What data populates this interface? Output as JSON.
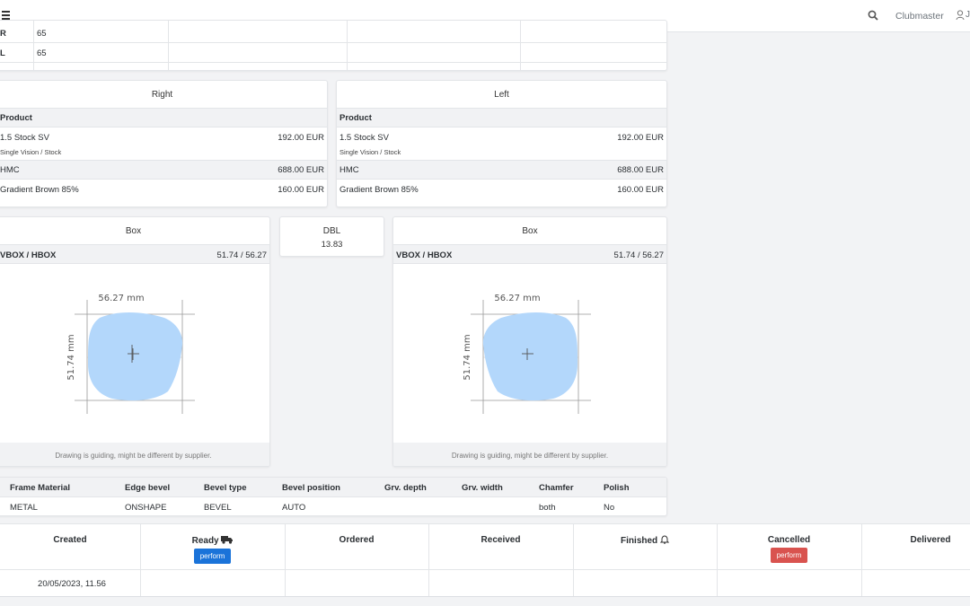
{
  "topbar": {
    "brand": "Clubmaster",
    "user_initial": "J"
  },
  "pd_table": {
    "rows": [
      {
        "side": "R",
        "value": "65"
      },
      {
        "side": "L",
        "value": "65"
      }
    ]
  },
  "lens_right": {
    "title": "Right",
    "product_label": "Product",
    "items": [
      {
        "name": "1.5 Stock SV",
        "sub": "Single Vision / Stock",
        "price": "192.00 EUR"
      },
      {
        "name": "HMC",
        "price": "688.00 EUR"
      },
      {
        "name": "Gradient Brown 85%",
        "price": "160.00 EUR"
      }
    ]
  },
  "lens_left": {
    "title": "Left",
    "product_label": "Product",
    "items": [
      {
        "name": "1.5 Stock SV",
        "sub": "Single Vision / Stock",
        "price": "192.00 EUR"
      },
      {
        "name": "HMC",
        "price": "688.00 EUR"
      },
      {
        "name": "Gradient Brown 85%",
        "price": "160.00 EUR"
      }
    ]
  },
  "box_right": {
    "title": "Box",
    "label": "VBOX / HBOX",
    "value": "51.74 / 56.27",
    "hbox": "56.27 mm",
    "vbox": "51.74 mm",
    "note": "Drawing is guiding, might be different by supplier."
  },
  "box_left": {
    "title": "Box",
    "label": "VBOX / HBOX",
    "value": "51.74 / 56.27",
    "hbox": "56.27 mm",
    "vbox": "51.74 mm",
    "note": "Drawing is guiding, might be different by supplier."
  },
  "dbl": {
    "label": "DBL",
    "value": "13.83"
  },
  "frame_specs": {
    "headers": [
      "Frame Material",
      "Edge bevel",
      "Bevel type",
      "Bevel position",
      "Grv. depth",
      "Grv. width",
      "Chamfer",
      "Polish"
    ],
    "values": [
      "METAL",
      "ONSHAPE",
      "BEVEL",
      "AUTO",
      "",
      "",
      "both",
      "No"
    ]
  },
  "timeline": {
    "columns": [
      "Created",
      "Ready",
      "Ordered",
      "Received",
      "Finished",
      "Cancelled",
      "Delivered"
    ],
    "created_value": "20/05/2023, 11.56",
    "perform_label": "perform",
    "colors": {
      "perform_blue": "#1a73d9",
      "perform_red": "#d9534f",
      "lens_fill": "#b3d7fb"
    }
  }
}
